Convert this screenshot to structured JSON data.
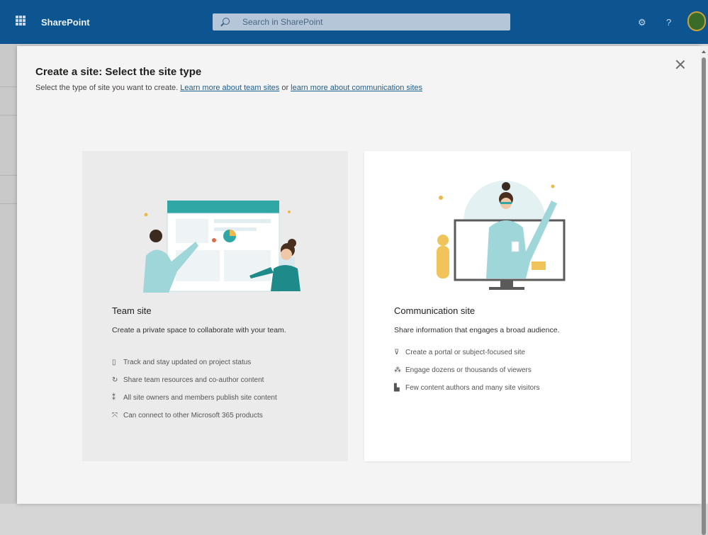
{
  "topbar": {
    "app_name": "SharePoint",
    "search_placeholder": "Search in SharePoint",
    "settings_icon": "⚙",
    "help_icon": "?",
    "avatar_initial": ""
  },
  "dialog": {
    "title": "Create a site: Select the site type",
    "subtitle_prefix": "Select the type of site you want to create.",
    "link_team": "Learn more about team sites",
    "subtitle_or": "or",
    "link_comm": "learn more about communication sites"
  },
  "cards": {
    "team": {
      "title": "Team site",
      "description": "Create a private space to collaborate with your team.",
      "features": [
        {
          "icon": "clipboard-icon",
          "glyph": "▯",
          "text": "Track and stay updated on project status"
        },
        {
          "icon": "share-icon",
          "glyph": "↻",
          "text": "Share team resources and co-author content"
        },
        {
          "icon": "people-icon",
          "glyph": "⁑",
          "text": "All site owners and members publish site content"
        },
        {
          "icon": "connect-icon",
          "glyph": "⤧",
          "text": "Can connect to other Microsoft 365 products"
        }
      ]
    },
    "comm": {
      "title": "Communication site",
      "description": "Share information that engages a broad audience.",
      "features": [
        {
          "icon": "megaphone-icon",
          "glyph": "⊽",
          "text": "Create a portal or subject-focused site"
        },
        {
          "icon": "audience-icon",
          "glyph": "⁂",
          "text": "Engage dozens or thousands of viewers"
        },
        {
          "icon": "author-icon",
          "glyph": "▙",
          "text": "Few content authors and many site visitors"
        }
      ]
    }
  }
}
